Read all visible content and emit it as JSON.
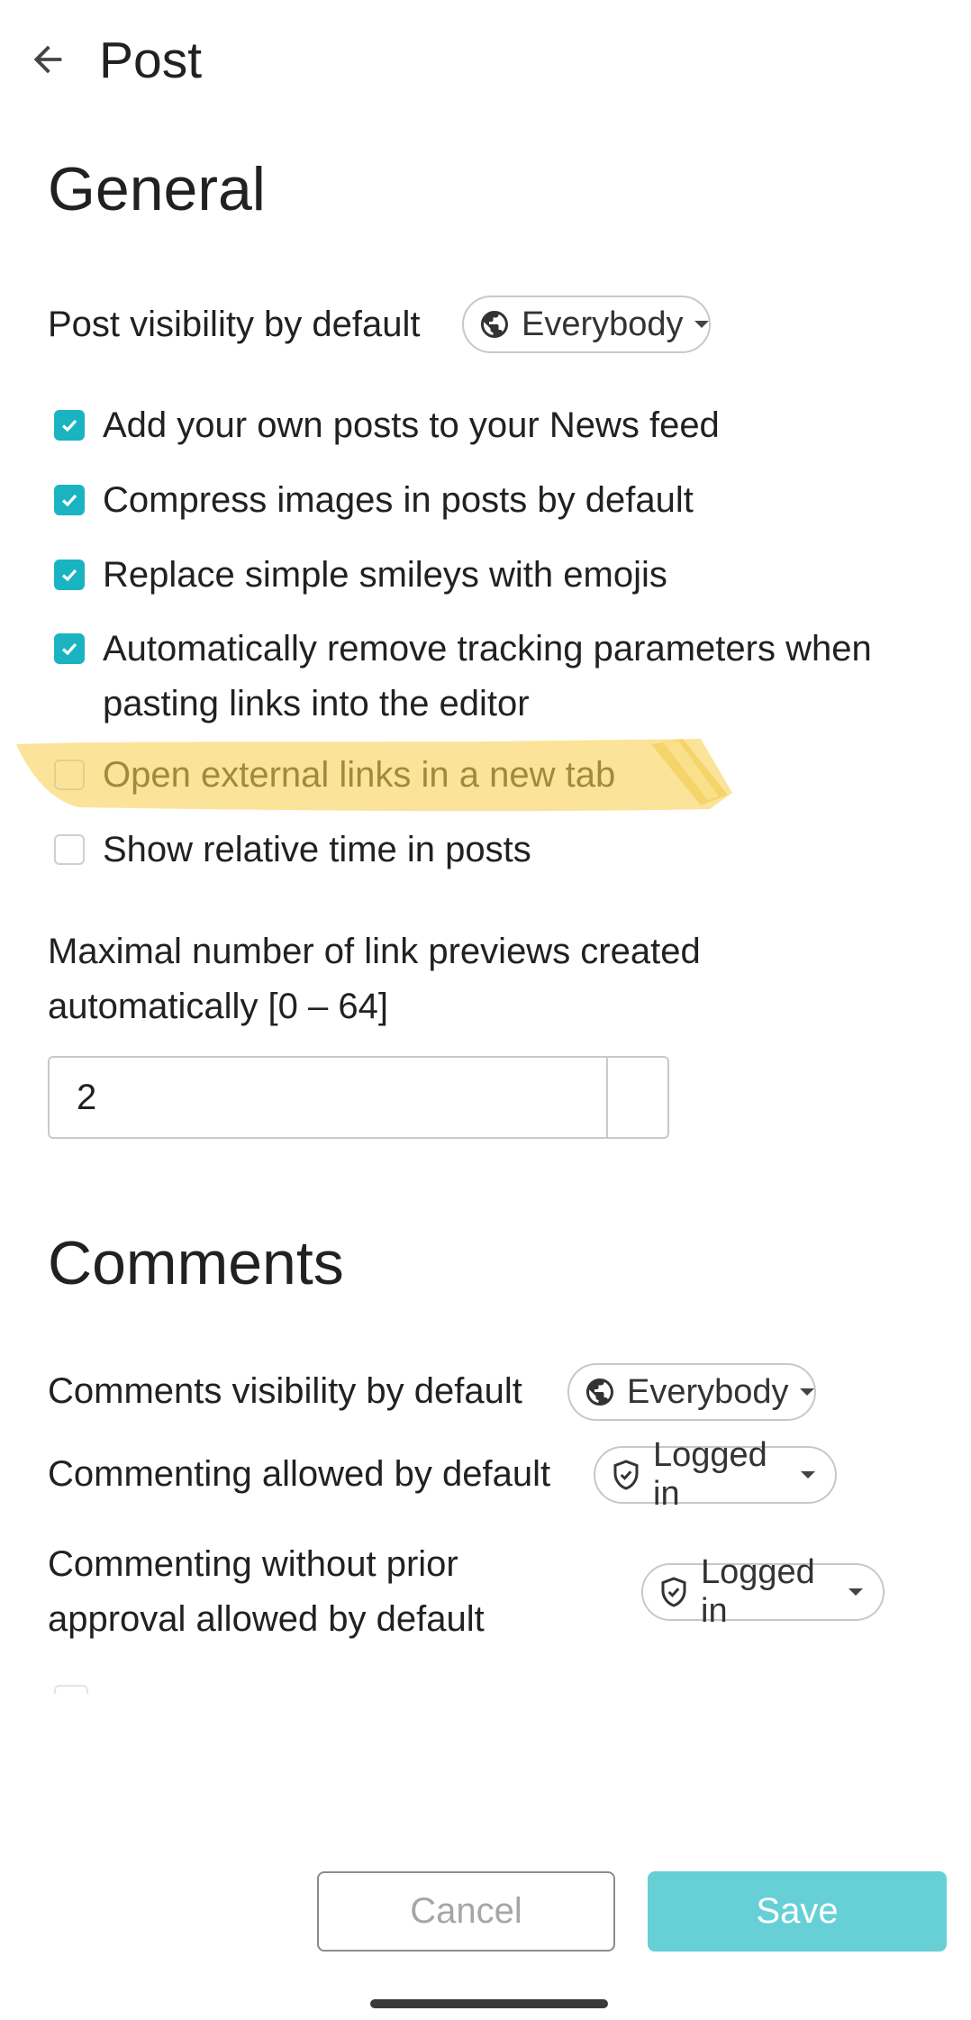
{
  "header": {
    "title": "Post",
    "back_icon": "arrow-back-icon"
  },
  "general": {
    "title": "General",
    "post_visibility": {
      "label": "Post visibility by default",
      "value": "Everybody",
      "icon": "globe-icon"
    },
    "checkboxes": [
      {
        "label": "Add your own posts to your News feed",
        "checked": true
      },
      {
        "label": "Compress images in posts by default",
        "checked": true
      },
      {
        "label": "Replace simple smileys with emojis",
        "checked": true
      },
      {
        "label": "Automatically remove tracking parameters when pasting links into the editor",
        "checked": true
      },
      {
        "label": "Open external links in a new tab",
        "checked": false,
        "highlighted": true
      },
      {
        "label": "Show relative time in posts",
        "checked": false
      }
    ],
    "link_previews": {
      "label": "Maximal number of link previews created automatically [0 – 64]",
      "value": "2"
    }
  },
  "comments": {
    "title": "Comments",
    "visibility": {
      "label": "Comments visibility by default",
      "value": "Everybody",
      "icon": "globe-icon"
    },
    "commenting_allowed": {
      "label": "Commenting allowed by default",
      "value": "Logged in",
      "icon": "shield-icon"
    },
    "commenting_without_approval": {
      "label": "Commenting without prior approval allowed by default",
      "value": "Logged in",
      "icon": "shield-icon"
    }
  },
  "footer": {
    "cancel_label": "Cancel",
    "save_label": "Save"
  },
  "colors": {
    "accent": "#1ab3c1",
    "save_button": "#66d0d6",
    "highlight": "#fbe49a"
  }
}
